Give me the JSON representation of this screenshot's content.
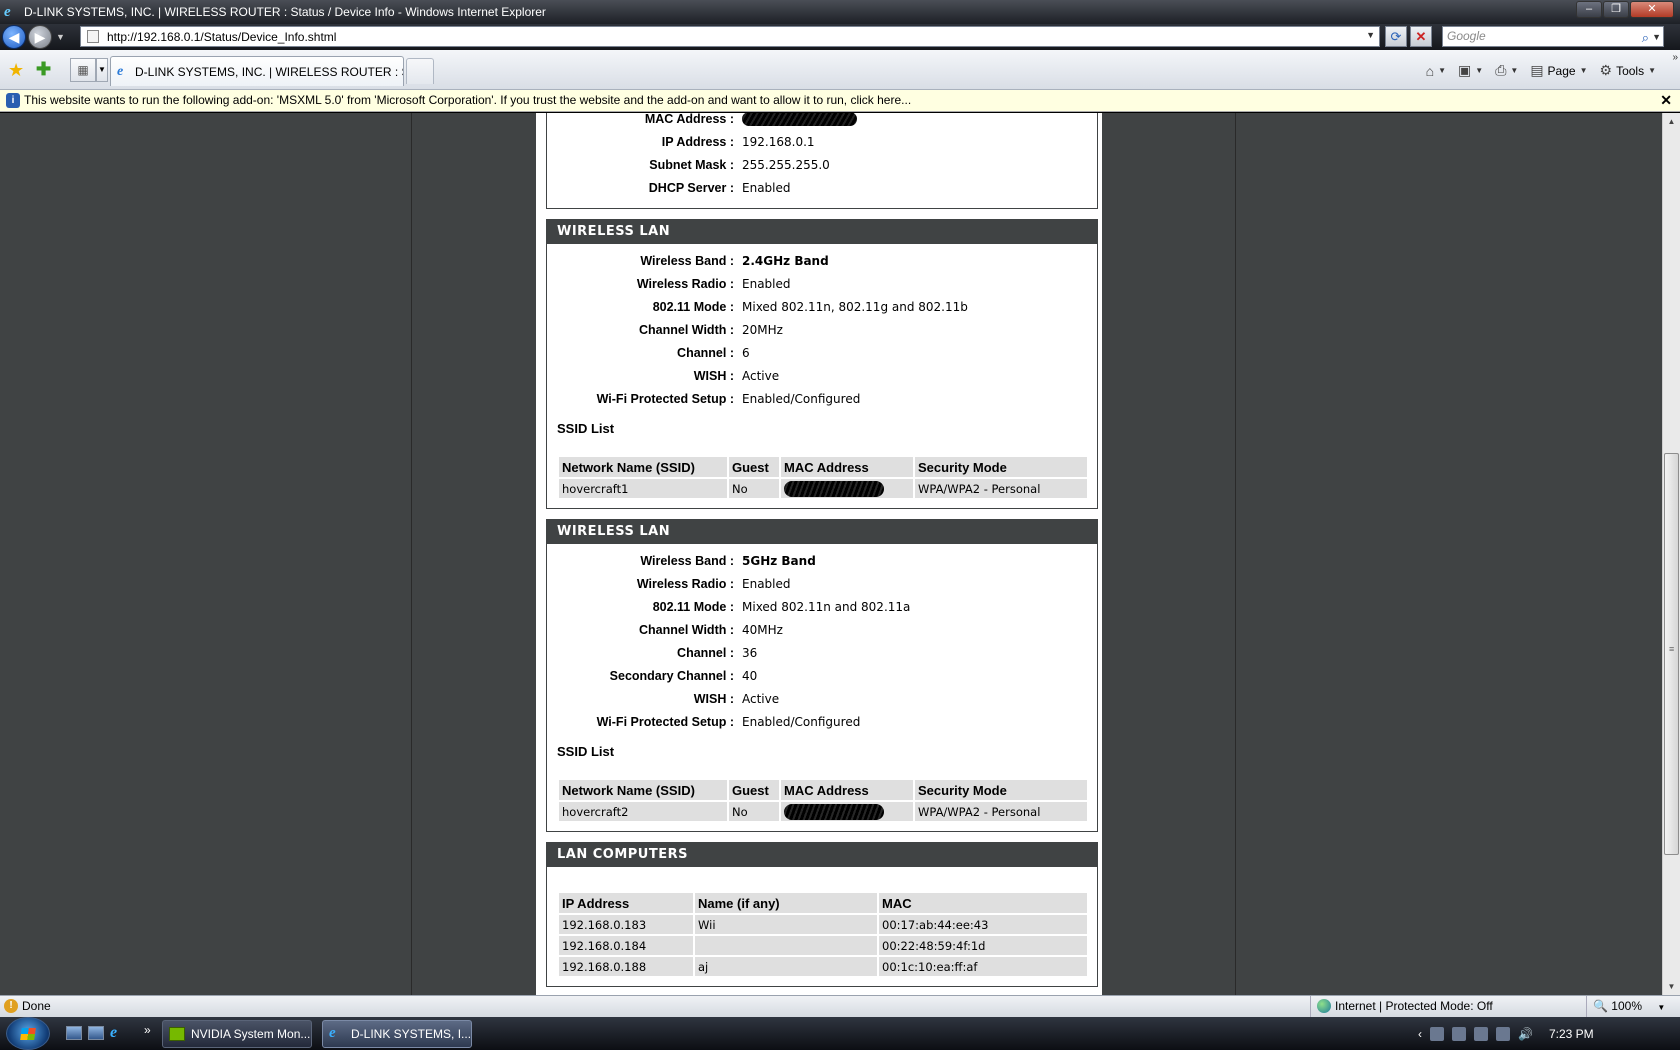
{
  "window": {
    "title": "D-LINK SYSTEMS, INC. | WIRELESS ROUTER : Status / Device Info - Windows Internet Explorer",
    "url": "http://192.168.0.1/Status/Device_Info.shtml",
    "search_placeholder": "Google",
    "tab_label": "D-LINK SYSTEMS, INC. | WIRELESS ROUTER : Stat...",
    "page_label": "Page",
    "tools_label": "Tools",
    "infobar": "This website wants to run the following add-on: 'MSXML 5.0' from 'Microsoft Corporation'. If you trust the website and the add-on and want to allow it to run, click here..."
  },
  "lan": {
    "rows": [
      {
        "key": "MAC Address :",
        "value": ""
      },
      {
        "key": "IP Address :",
        "value": "192.168.0.1"
      },
      {
        "key": "Subnet Mask :",
        "value": "255.255.255.0"
      },
      {
        "key": "DHCP Server :",
        "value": "Enabled"
      }
    ]
  },
  "wlan24": {
    "heading": "WIRELESS LAN",
    "rows": [
      {
        "key": "Wireless Band :",
        "value": "2.4GHz Band"
      },
      {
        "key": "Wireless Radio :",
        "value": "Enabled"
      },
      {
        "key": "802.11 Mode :",
        "value": "Mixed 802.11n, 802.11g and 802.11b"
      },
      {
        "key": "Channel Width :",
        "value": "20MHz"
      },
      {
        "key": "Channel :",
        "value": "6"
      },
      {
        "key": "WISH :",
        "value": "Active"
      },
      {
        "key": "Wi-Fi Protected Setup :",
        "value": "Enabled/Configured"
      }
    ],
    "ssid_title": "SSID List",
    "ssid_headers": [
      "Network Name (SSID)",
      "Guest",
      "MAC Address",
      "Security Mode"
    ],
    "ssid_row": {
      "name": "hovercraft1",
      "guest": "No",
      "security": "WPA/WPA2 - Personal"
    }
  },
  "wlan5": {
    "heading": "WIRELESS LAN",
    "rows": [
      {
        "key": "Wireless Band :",
        "value": "5GHz Band"
      },
      {
        "key": "Wireless Radio :",
        "value": "Enabled"
      },
      {
        "key": "802.11 Mode :",
        "value": "Mixed 802.11n and 802.11a"
      },
      {
        "key": "Channel Width :",
        "value": "40MHz"
      },
      {
        "key": "Channel :",
        "value": "36"
      },
      {
        "key": "Secondary Channel :",
        "value": "40"
      },
      {
        "key": "WISH :",
        "value": "Active"
      },
      {
        "key": "Wi-Fi Protected Setup :",
        "value": "Enabled/Configured"
      }
    ],
    "ssid_title": "SSID List",
    "ssid_headers": [
      "Network Name (SSID)",
      "Guest",
      "MAC Address",
      "Security Mode"
    ],
    "ssid_row": {
      "name": "hovercraft2",
      "guest": "No",
      "security": "WPA/WPA2 - Personal"
    }
  },
  "lan_computers": {
    "heading": "LAN COMPUTERS",
    "headers": [
      "IP Address",
      "Name (if any)",
      "MAC"
    ],
    "rows": [
      [
        "192.168.0.183",
        "Wii",
        "00:17:ab:44:ee:43"
      ],
      [
        "192.168.0.184",
        "",
        "00:22:48:59:4f:1d"
      ],
      [
        "192.168.0.188",
        "aj",
        "00:1c:10:ea:ff:af"
      ]
    ]
  },
  "statusbar": {
    "text": "Done",
    "zone": "Internet | Protected Mode: Off",
    "zoom": "100%"
  },
  "taskbar": {
    "items": [
      "NVIDIA System Mon...",
      "D-LINK SYSTEMS, I..."
    ],
    "clock": "7:23 PM"
  }
}
